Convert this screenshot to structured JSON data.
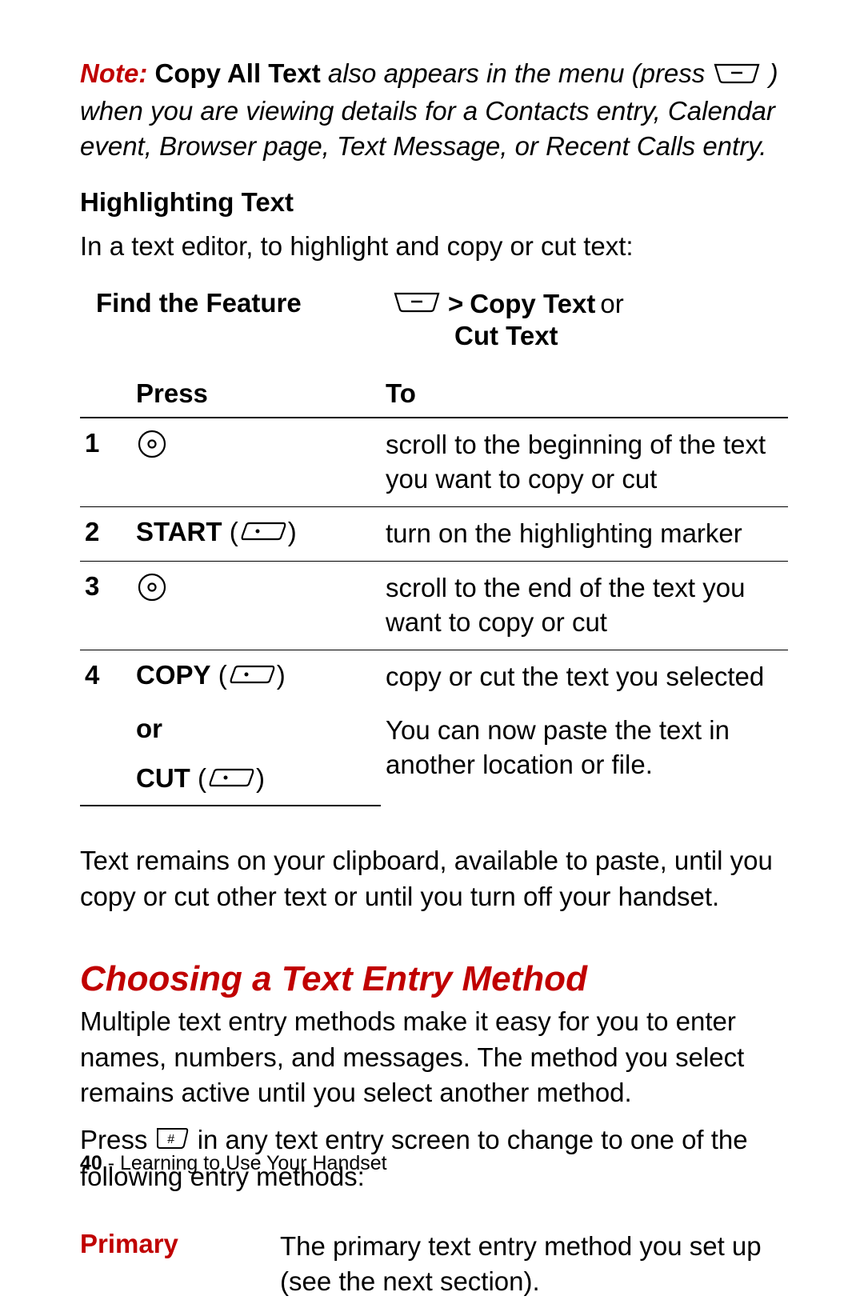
{
  "note": {
    "label": "Note:",
    "bold_term": "Copy All Text",
    "tail_before_icon": " also appears in the menu (press ",
    "tail_after_icon": " ) when you are viewing details for a Contacts entry, Calendar event, Browser page, Text Message, or Recent Calls entry."
  },
  "highlighting": {
    "heading": "Highlighting Text",
    "intro": "In a text editor, to highlight and copy or cut text:"
  },
  "feature": {
    "left": "Find the Feature",
    "gt": ">",
    "copy_text": "Copy Text",
    "or": " or",
    "cut_text": "Cut Text"
  },
  "table": {
    "head_press": "Press",
    "head_to": "To",
    "rows": [
      {
        "n": "1",
        "key_label": "",
        "key_type": "nav",
        "to": "scroll to the beginning of the text you want to copy or cut"
      },
      {
        "n": "2",
        "key_label": "START",
        "key_type": "soft",
        "to": "turn on the highlighting marker"
      },
      {
        "n": "3",
        "key_label": "",
        "key_type": "nav",
        "to": "scroll to the end of the text you want to copy or cut"
      },
      {
        "n": "4",
        "key_label": "COPY",
        "key_type": "soft",
        "to": "copy or cut the text you selected"
      }
    ],
    "or_label": "or",
    "cut_label": "CUT",
    "paste_note": "You can now paste the text in another location or file."
  },
  "clipboard_note": "Text remains on your clipboard, available to paste, until you copy or cut other text or until you turn off your handset.",
  "choosing": {
    "heading": "Choosing a Text Entry Method",
    "p1": "Multiple text entry methods make it easy for you to enter names, numbers, and messages. The method you select remains active until you select another method.",
    "p2_before": "Press ",
    "p2_after": " in any text entry screen to change to one of the following entry methods:"
  },
  "primary": {
    "label": "Primary",
    "desc": "The primary text entry method you set up (see the next section)."
  },
  "footer": {
    "page": "40",
    "sep": " - ",
    "section": "Learning to Use Your Handset"
  }
}
